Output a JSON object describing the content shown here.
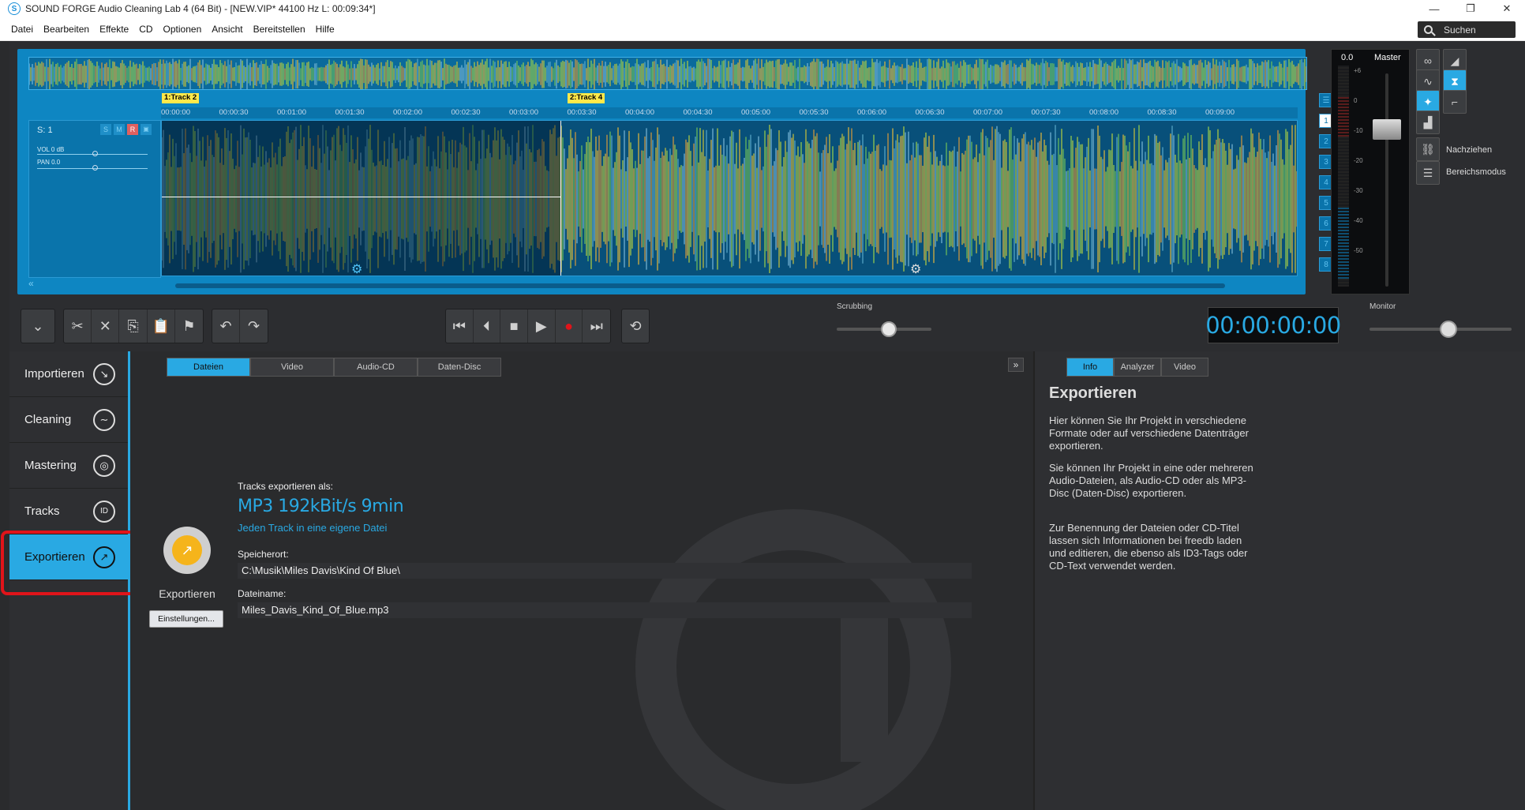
{
  "window": {
    "title": "SOUND FORGE Audio Cleaning Lab 4 (64 Bit) - [NEW.VIP*   44100 Hz L: 00:09:34*]",
    "app_icon": "S",
    "minimize": "—",
    "maximize": "❐",
    "close": "✕"
  },
  "menu": [
    "Datei",
    "Bearbeiten",
    "Effekte",
    "CD",
    "Optionen",
    "Ansicht",
    "Bereitstellen",
    "Hilfe"
  ],
  "search": {
    "placeholder": "Suchen"
  },
  "editor": {
    "track_markers": [
      "1:Track 2",
      "2:Track 4"
    ],
    "ruler": [
      "00:00:00",
      "00:00:30",
      "00:01:00",
      "00:01:30",
      "00:02:00",
      "00:02:30",
      "00:03:00",
      "00:03:30",
      "00:04:00",
      "00:04:30",
      "00:05:00",
      "00:05:30",
      "00:06:00",
      "00:06:30",
      "00:07:00",
      "00:07:30",
      "00:08:00",
      "00:08:30",
      "00:09:00"
    ],
    "track_header": {
      "name": "S: 1",
      "solo": "S",
      "mute": "M",
      "rec": "R",
      "vol": "VOL  0 dB",
      "pan": "PAN   0.0"
    },
    "track_numbers": [
      "1",
      "2",
      "3",
      "4",
      "5",
      "6",
      "7",
      "8"
    ],
    "active_track": "1"
  },
  "meter": {
    "value": "0.0",
    "label": "Master",
    "scale": [
      "+6",
      "0",
      "-10",
      "-20",
      "-30",
      "-40",
      "-50"
    ]
  },
  "right_tools": {
    "nachziehen": "Nachziehen",
    "bereichsmodus": "Bereichsmodus"
  },
  "transport": {
    "scrubbing_label": "Scrubbing",
    "time": "00:00:00:00",
    "monitor_label": "Monitor"
  },
  "nav": [
    {
      "label": "Importieren",
      "icon": "↘"
    },
    {
      "label": "Cleaning",
      "icon": "∼"
    },
    {
      "label": "Mastering",
      "icon": "◎"
    },
    {
      "label": "Tracks",
      "icon": "ID"
    },
    {
      "label": "Exportieren",
      "icon": "↗"
    }
  ],
  "center": {
    "tabs": [
      "Dateien",
      "Video",
      "Audio-CD",
      "Daten-Disc"
    ],
    "active_tab": "Dateien",
    "export_button_label": "Exportieren",
    "settings_button": "Einstellungen...",
    "tracks_label": "Tracks exportieren als:",
    "format": "MP3  192kBit/s  9min",
    "format_sub": "Jeden Track in eine eigene Datei",
    "location_label": "Speicherort:",
    "location_value": "C:\\Musik\\Miles Davis\\Kind Of Blue\\",
    "filename_label": "Dateiname:",
    "filename_value": "Miles_Davis_Kind_Of_Blue.mp3",
    "expander": "»"
  },
  "right_panel": {
    "tabs": [
      "Info",
      "Analyzer",
      "Video"
    ],
    "title": "Exportieren",
    "p1": "Hier können Sie Ihr Projekt in verschiedene Formate oder auf verschiedene Datenträger exportieren.",
    "p2": "Sie können Ihr Projekt in eine oder mehreren Audio-Dateien, als Audio-CD oder als MP3-Disc (Daten-Disc) exportieren.",
    "p3": "Zur Benennung der Dateien oder CD-Titel lassen sich Informationen bei freedb laden und editieren, die ebenso als ID3-Tags oder CD-Text verwendet werden."
  },
  "colors": {
    "accent": "#29a9e3",
    "editor_bg": "#0e86c2",
    "highlight": "#e0141a"
  }
}
